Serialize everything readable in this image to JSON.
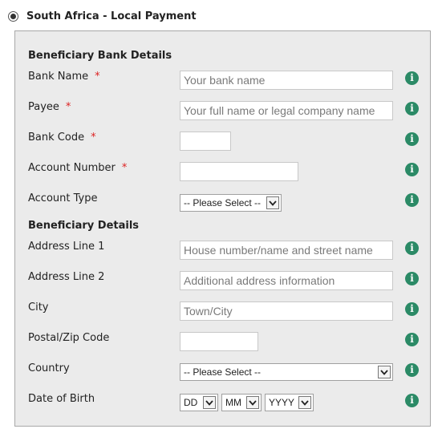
{
  "header": {
    "label": "South Africa - Local Payment",
    "selected": true
  },
  "sections": {
    "bank": "Beneficiary Bank Details",
    "beneficiary": "Beneficiary Details"
  },
  "fields": {
    "bank_name": {
      "label": "Bank Name",
      "required": "*",
      "placeholder": "Your bank name"
    },
    "payee": {
      "label": "Payee",
      "required": "*",
      "placeholder": "Your full name or legal company name"
    },
    "bank_code": {
      "label": "Bank Code",
      "required": "*",
      "value": ""
    },
    "account_number": {
      "label": "Account Number",
      "required": "*",
      "value": ""
    },
    "account_type": {
      "label": "Account Type",
      "selected": "-- Please Select --"
    },
    "address1": {
      "label": "Address Line 1",
      "placeholder": "House number/name and street name"
    },
    "address2": {
      "label": "Address Line 2",
      "placeholder": "Additional address information"
    },
    "city": {
      "label": "City",
      "placeholder": "Town/City"
    },
    "postal": {
      "label": "Postal/Zip Code",
      "value": ""
    },
    "country": {
      "label": "Country",
      "selected": "-- Please Select --"
    },
    "dob": {
      "label": "Date of Birth",
      "day": "DD",
      "month": "MM",
      "year": "YYYY"
    }
  },
  "info_glyph": "i",
  "icons": {
    "info": "info-icon",
    "dropdown": "chevron-down-icon",
    "radio": "radio-selected"
  },
  "colors": {
    "info": "#2b8a66",
    "required": "#dd2222",
    "panel_bg": "#ebebeb"
  }
}
